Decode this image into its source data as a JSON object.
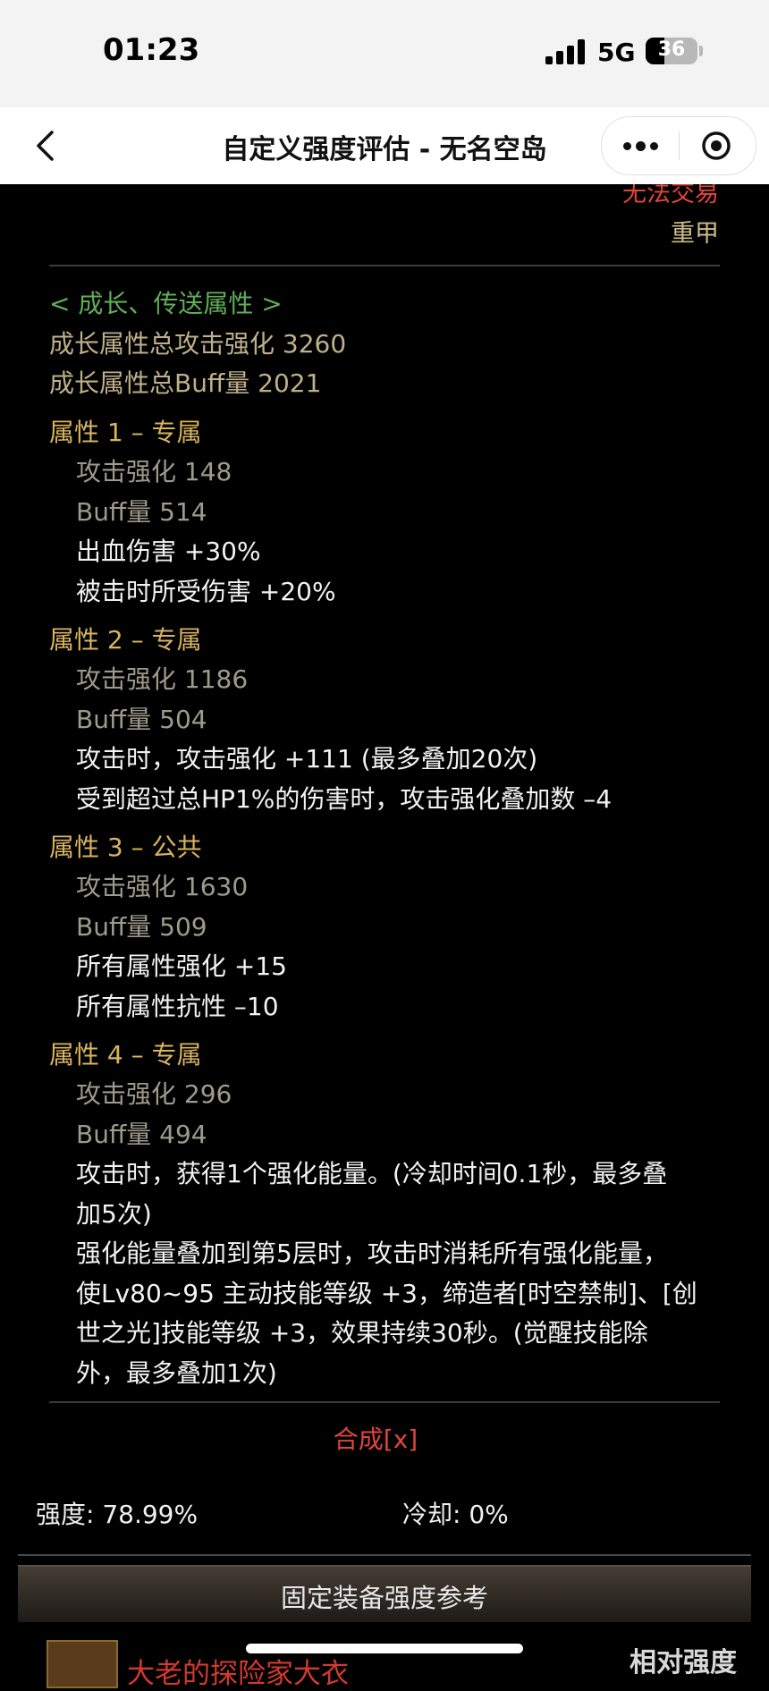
{
  "status": {
    "time": "01:23",
    "network": "5G",
    "battery": "36",
    "battery_level_percent": 36
  },
  "nav": {
    "title": "自定义强度评估 - 无名空岛"
  },
  "item": {
    "trade": "无法交易",
    "armor_type": "重甲"
  },
  "growth": {
    "header": "< 成长、传送属性 >",
    "total_attack": "成长属性总攻击强化 3260",
    "total_buff": "成长属性总Buff量 2021"
  },
  "attributes": [
    {
      "title": "属性 1 – 专属",
      "attack": "攻击强化  148",
      "buff": "Buff量  514",
      "effects": [
        "出血伤害 +30%",
        "被击时所受伤害 +20%"
      ]
    },
    {
      "title": "属性 2 – 专属",
      "attack": "攻击强化  1186",
      "buff": "Buff量  504",
      "effects": [
        "攻击时，攻击强化 +111 (最多叠加20次)",
        "受到超过总HP1%的伤害时，攻击强化叠加数 –4"
      ]
    },
    {
      "title": "属性 3 – 公共",
      "attack": "攻击强化  1630",
      "buff": "Buff量  509",
      "effects": [
        "所有属性强化 +15",
        "所有属性抗性 –10"
      ]
    },
    {
      "title": "属性 4 – 专属",
      "attack": "攻击强化  296",
      "buff": "Buff量  494",
      "effects": [
        "攻击时，获得1个强化能量。(冷却时间0.1秒，最多叠",
        "加5次)",
        "强化能量叠加到第5层时，攻击时消耗所有强化能量，",
        "使Lv80~95 主动技能等级 +3，缔造者[时空禁制]、[创",
        "世之光]技能等级 +3，效果持续30秒。(觉醒技能除",
        "外，最多叠加1次)"
      ]
    }
  ],
  "synth": "合成[x]",
  "stats": {
    "strength": "强度: 78.99%",
    "cooldown": "冷却: 0%"
  },
  "reference": {
    "title": "固定装备强度参考",
    "first_item": "大老的探险家大衣",
    "relative_title": "相对强度"
  }
}
